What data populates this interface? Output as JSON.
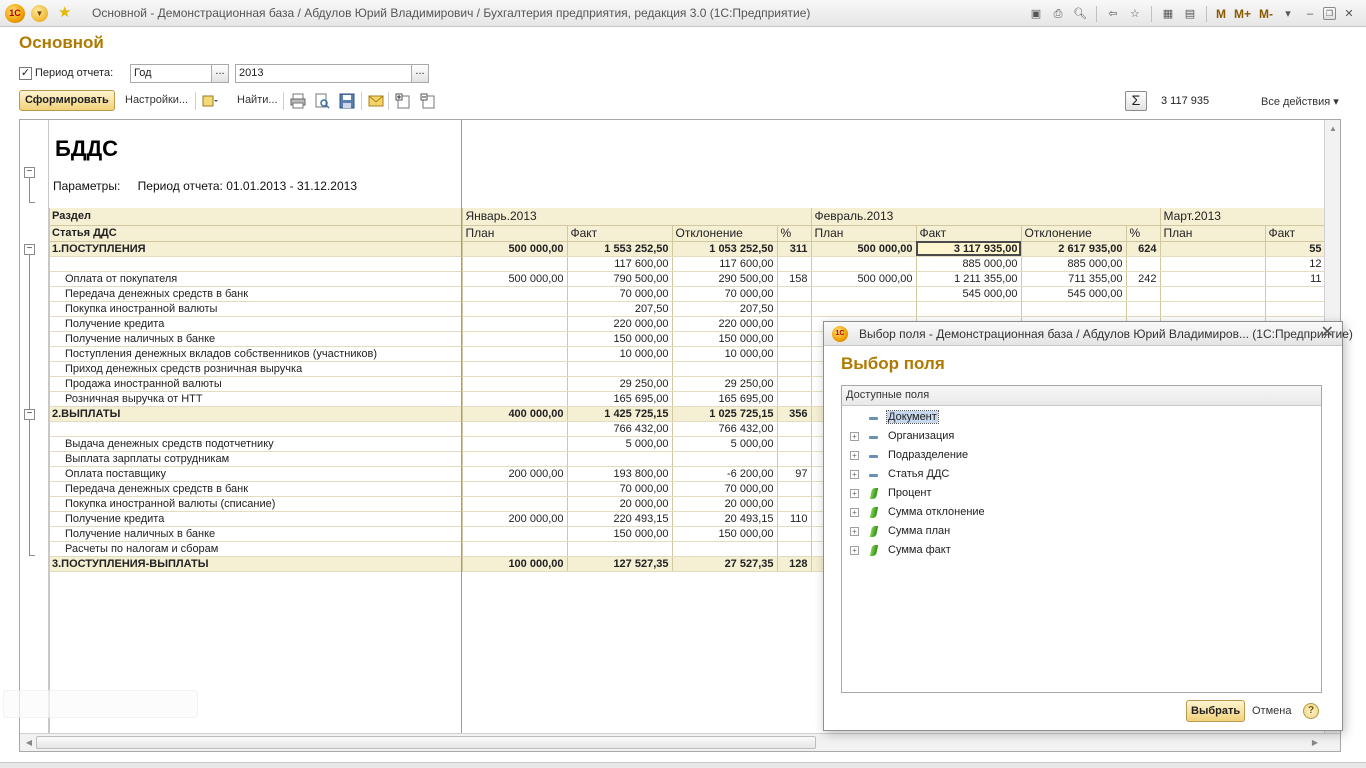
{
  "window": {
    "title": "Основной - Демонстрационная база / Абдулов Юрий Владимирович / Бухгалтерия предприятия, редакция 3.0  (1С:Предприятие)",
    "logo": "1С",
    "toolbar_text": [
      "M",
      "M+",
      "M-"
    ]
  },
  "form": {
    "title": "Основной",
    "period_checkbox_label": "Период отчета:",
    "period_checked": true,
    "period_type": "Год",
    "period_value": "2013",
    "button_select": "...",
    "generate_button": "Сформировать",
    "settings_link": "Настройки...",
    "find_link": "Найти...",
    "sum_icon": "Σ",
    "sum_value": "3 117 935",
    "all_actions": "Все действия"
  },
  "report": {
    "title": "БДДС",
    "params_label": "Параметры:",
    "params_value": "Период отчета: 01.01.2013 - 31.12.2013",
    "header_section": "Раздел",
    "header_article": "Статья ДДС",
    "months": [
      "Январь.2013",
      "Февраль.2013",
      "Март.2013"
    ],
    "subcolumns": [
      "План",
      "Факт",
      "Отклонение",
      "%"
    ],
    "rows": [
      {
        "type": "sec",
        "name": "1.ПОСТУПЛЕНИЯ",
        "jan": [
          "500 000,00",
          "1 553 252,50",
          "1 053 252,50",
          "311"
        ],
        "feb": [
          "500 000,00",
          "3 117 935,00",
          "2 617 935,00",
          "624"
        ],
        "mar": [
          "",
          "55"
        ]
      },
      {
        "type": "sub",
        "name": "",
        "jan": [
          "",
          "117 600,00",
          "117 600,00",
          ""
        ],
        "feb": [
          "",
          "885 000,00",
          "885 000,00",
          ""
        ],
        "mar": [
          "",
          "12"
        ]
      },
      {
        "type": "sub",
        "name": "Оплата от покупателя",
        "jan": [
          "500 000,00",
          "790 500,00",
          "290 500,00",
          "158"
        ],
        "feb": [
          "500 000,00",
          "1 211 355,00",
          "711 355,00",
          "242"
        ],
        "mar": [
          "",
          "11"
        ]
      },
      {
        "type": "sub",
        "name": "Передача денежных средств в банк",
        "jan": [
          "",
          "70 000,00",
          "70 000,00",
          ""
        ],
        "feb": [
          "",
          "545 000,00",
          "545 000,00",
          ""
        ],
        "mar": [
          "",
          ""
        ]
      },
      {
        "type": "sub",
        "name": "Покупка иностранной валюты",
        "jan": [
          "",
          "207,50",
          "207,50",
          ""
        ],
        "feb": [
          "",
          "",
          "",
          ""
        ],
        "mar": [
          "",
          ""
        ]
      },
      {
        "type": "sub",
        "name": "Получение кредита",
        "jan": [
          "",
          "220 000,00",
          "220 000,00",
          ""
        ],
        "feb": [
          "",
          "",
          "",
          ""
        ],
        "mar": [
          "",
          ""
        ]
      },
      {
        "type": "sub",
        "name": "Получение наличных в банке",
        "jan": [
          "",
          "150 000,00",
          "150 000,00",
          ""
        ],
        "feb": [
          "",
          "",
          "",
          ""
        ],
        "mar": [
          "",
          ""
        ]
      },
      {
        "type": "sub",
        "name": "Поступления денежных вкладов собственников (участников)",
        "jan": [
          "",
          "10 000,00",
          "10 000,00",
          ""
        ],
        "feb": [
          "",
          "",
          "",
          ""
        ],
        "mar": [
          "",
          ""
        ]
      },
      {
        "type": "sub",
        "name": "Приход денежных средств розничная выручка",
        "jan": [
          "",
          "",
          "",
          ""
        ],
        "feb": [
          "",
          "",
          "",
          ""
        ],
        "mar": [
          "",
          ""
        ]
      },
      {
        "type": "sub",
        "name": "Продажа иностранной валюты",
        "jan": [
          "",
          "29 250,00",
          "29 250,00",
          ""
        ],
        "feb": [
          "",
          "",
          "",
          ""
        ],
        "mar": [
          "",
          ""
        ]
      },
      {
        "type": "sub",
        "name": "Розничная выручка от НТТ",
        "jan": [
          "",
          "165 695,00",
          "165 695,00",
          ""
        ],
        "feb": [
          "",
          "",
          "",
          ""
        ],
        "mar": [
          "",
          ""
        ]
      },
      {
        "type": "sec",
        "name": "2.ВЫПЛАТЫ",
        "jan": [
          "400 000,00",
          "1 425 725,15",
          "1 025 725,15",
          "356"
        ],
        "feb": [
          "",
          "",
          "",
          ""
        ],
        "mar": [
          "",
          ""
        ]
      },
      {
        "type": "sub",
        "name": "",
        "jan": [
          "",
          "766 432,00",
          "766 432,00",
          ""
        ],
        "feb": [
          "",
          "",
          "",
          ""
        ],
        "mar": [
          "",
          ""
        ]
      },
      {
        "type": "sub",
        "name": "Выдача денежных средств подотчетнику",
        "jan": [
          "",
          "5 000,00",
          "5 000,00",
          ""
        ],
        "feb": [
          "",
          "",
          "",
          ""
        ],
        "mar": [
          "",
          ""
        ]
      },
      {
        "type": "sub",
        "name": "Выплата зарплаты сотрудникам",
        "jan": [
          "",
          "",
          "",
          ""
        ],
        "feb": [
          "",
          "",
          "",
          ""
        ],
        "mar": [
          "",
          ""
        ]
      },
      {
        "type": "sub",
        "name": "Оплата поставщику",
        "jan": [
          "200 000,00",
          "193 800,00",
          "-6 200,00",
          "97"
        ],
        "feb": [
          "",
          "",
          "",
          ""
        ],
        "mar": [
          "",
          ""
        ]
      },
      {
        "type": "sub",
        "name": "Передача денежных средств в банк",
        "jan": [
          "",
          "70 000,00",
          "70 000,00",
          ""
        ],
        "feb": [
          "",
          "",
          "",
          ""
        ],
        "mar": [
          "",
          ""
        ]
      },
      {
        "type": "sub",
        "name": "Покупка иностранной валюты (списание)",
        "jan": [
          "",
          "20 000,00",
          "20 000,00",
          ""
        ],
        "feb": [
          "",
          "",
          "",
          ""
        ],
        "mar": [
          "",
          ""
        ]
      },
      {
        "type": "sub",
        "name": "Получение кредита",
        "jan": [
          "200 000,00",
          "220 493,15",
          "20 493,15",
          "110"
        ],
        "feb": [
          "",
          "",
          "",
          ""
        ],
        "mar": [
          "",
          ""
        ]
      },
      {
        "type": "sub",
        "name": "Получение наличных в банке",
        "jan": [
          "",
          "150 000,00",
          "150 000,00",
          ""
        ],
        "feb": [
          "",
          "",
          "",
          ""
        ],
        "mar": [
          "",
          ""
        ]
      },
      {
        "type": "sub",
        "name": "Расчеты по налогам и сборам",
        "jan": [
          "",
          "",
          "",
          ""
        ],
        "feb": [
          "",
          "",
          "",
          ""
        ],
        "mar": [
          "",
          ""
        ]
      },
      {
        "type": "sec",
        "name": "3.ПОСТУПЛЕНИЯ-ВЫПЛАТЫ",
        "jan": [
          "100 000,00",
          "127 527,35",
          "27 527,35",
          "128"
        ],
        "feb": [
          "",
          "",
          "",
          ""
        ],
        "mar": [
          "",
          ""
        ]
      }
    ]
  },
  "dialog": {
    "title": "Выбор поля - Демонстрационная база / Абдулов Юрий Владимиров...  (1С:Предприятие)",
    "heading": "Выбор поля",
    "tree_header": "Доступные поля",
    "items": [
      {
        "label": "Документ",
        "icon": "dimension-icon",
        "expandable": false,
        "selected": true
      },
      {
        "label": "Организация",
        "icon": "dimension-icon",
        "expandable": true,
        "selected": false
      },
      {
        "label": "Подразделение",
        "icon": "dimension-icon",
        "expandable": true,
        "selected": false
      },
      {
        "label": "Статья ДДС",
        "icon": "dimension-icon",
        "expandable": true,
        "selected": false
      },
      {
        "label": "Процент",
        "icon": "resource-icon",
        "expandable": true,
        "selected": false
      },
      {
        "label": "Сумма отклонение",
        "icon": "resource-icon",
        "expandable": true,
        "selected": false
      },
      {
        "label": "Сумма план",
        "icon": "resource-icon",
        "expandable": true,
        "selected": false
      },
      {
        "label": "Сумма факт",
        "icon": "resource-icon",
        "expandable": true,
        "selected": false
      }
    ],
    "ok_button": "Выбрать",
    "cancel_button": "Отмена",
    "help_button": "?"
  },
  "colors": {
    "accent": "#b07a00",
    "header_bg": "#f5efd4",
    "button_bg": "#f1d27a"
  }
}
